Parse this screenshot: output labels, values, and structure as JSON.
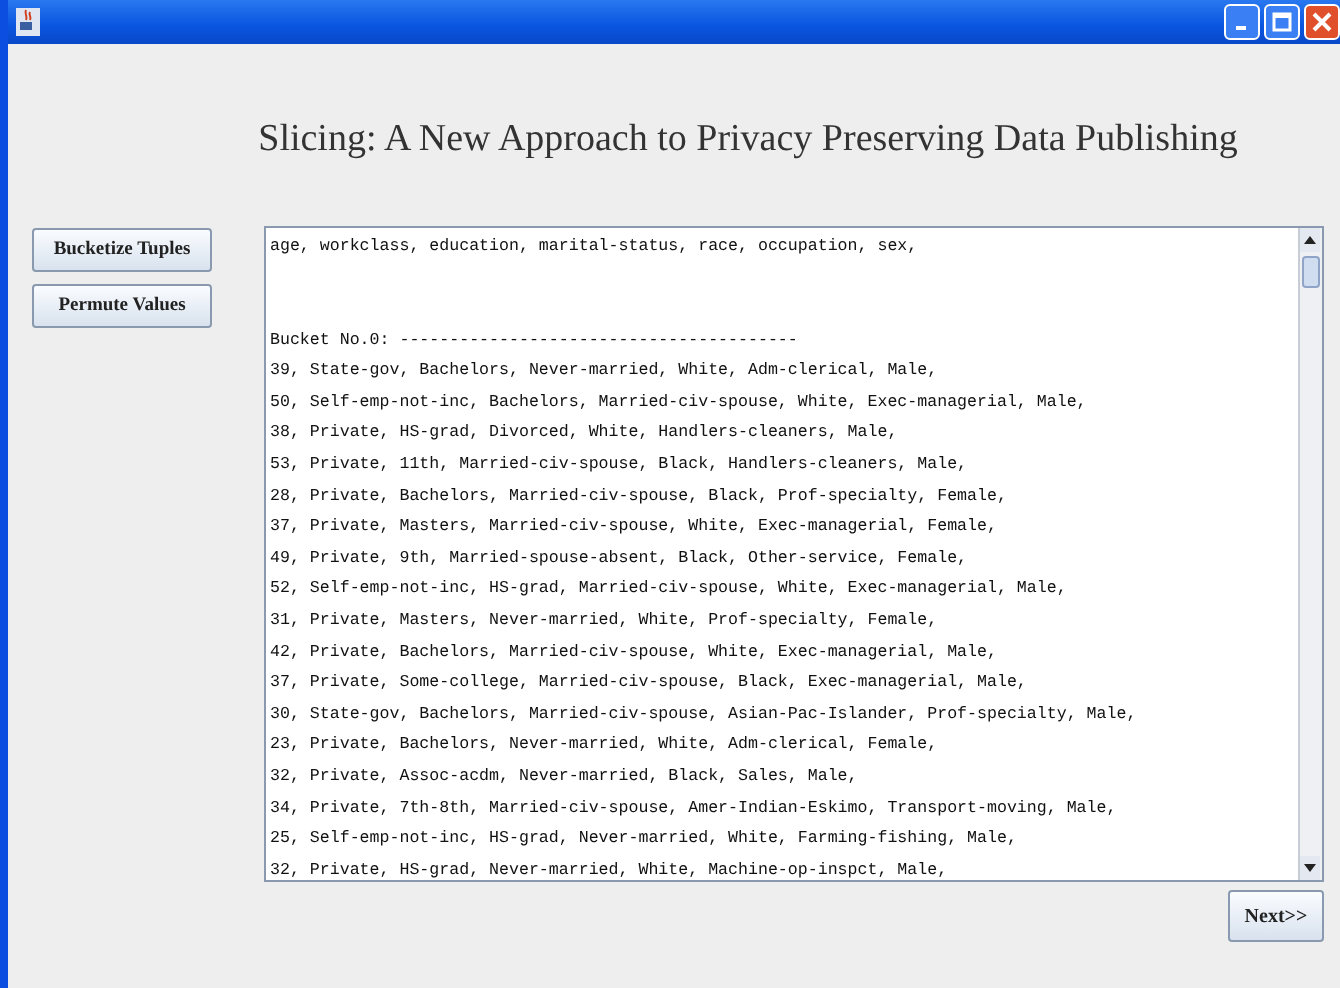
{
  "title": "Slicing: A New Approach to Privacy Preserving Data Publishing",
  "buttons": [
    "Bucketize Tuples",
    "Permute Values"
  ],
  "output": {
    "header": "age, workclass, education, marital-status, race, occupation, sex,",
    "bucket_title": "Bucket No.0: ----------------------------------------",
    "rows": [
      "39, State-gov, Bachelors, Never-married, White, Adm-clerical, Male,",
      "50, Self-emp-not-inc, Bachelors, Married-civ-spouse, White, Exec-managerial, Male,",
      "38, Private, HS-grad, Divorced, White, Handlers-cleaners, Male,",
      "53, Private, 11th, Married-civ-spouse, Black, Handlers-cleaners, Male,",
      "28, Private, Bachelors, Married-civ-spouse, Black, Prof-specialty, Female,",
      "37, Private, Masters, Married-civ-spouse, White, Exec-managerial, Female,",
      "49, Private, 9th, Married-spouse-absent, Black, Other-service, Female,",
      "52, Self-emp-not-inc, HS-grad, Married-civ-spouse, White, Exec-managerial, Male,",
      "31, Private, Masters, Never-married, White, Prof-specialty, Female,",
      "42, Private, Bachelors, Married-civ-spouse, White, Exec-managerial, Male,",
      "37, Private, Some-college, Married-civ-spouse, Black, Exec-managerial, Male,",
      "30, State-gov, Bachelors, Married-civ-spouse, Asian-Pac-Islander, Prof-specialty, Male,",
      "23, Private, Bachelors, Never-married, White, Adm-clerical, Female,",
      "32, Private, Assoc-acdm, Never-married, Black, Sales, Male,",
      "34, Private, 7th-8th, Married-civ-spouse, Amer-Indian-Eskimo, Transport-moving, Male,",
      "25, Self-emp-not-inc, HS-grad, Never-married, White, Farming-fishing, Male,",
      "32, Private, HS-grad, Never-married, White, Machine-op-inspct, Male,"
    ]
  },
  "next_button": "Next>>"
}
